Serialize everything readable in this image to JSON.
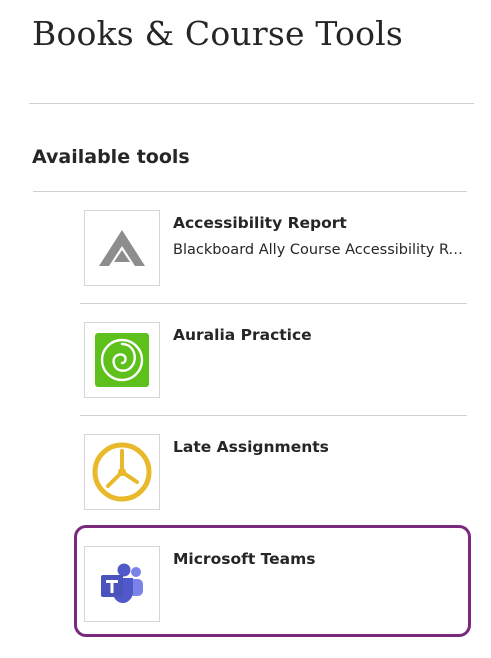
{
  "page": {
    "title": "Books & Course Tools"
  },
  "section": {
    "title": "Available tools"
  },
  "tools": [
    {
      "name": "Accessibility Report",
      "description": "Blackboard Ally Course Accessibility Report",
      "icon": "ally-a-icon"
    },
    {
      "name": "Auralia Practice",
      "description": "",
      "icon": "auralia-spiral-icon"
    },
    {
      "name": "Late Assignments",
      "description": "",
      "icon": "clock-icon"
    },
    {
      "name": "Microsoft Teams",
      "description": "",
      "icon": "microsoft-teams-icon"
    }
  ],
  "colors": {
    "highlight": "#7a2a7d",
    "auralia_green": "#5dc01b",
    "clock_gold": "#e8b92a",
    "teams_purple": "#5059c9",
    "ally_gray": "#8d8d8d"
  }
}
